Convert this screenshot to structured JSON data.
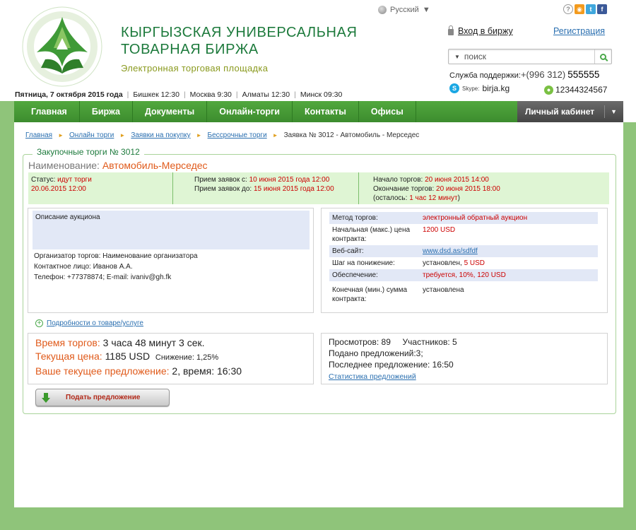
{
  "header": {
    "title_line1": "КЫРГЫЗСКАЯ УНИВЕРСАЛЬНАЯ",
    "title_line2": "ТОВАРНАЯ БИРЖА",
    "subtitle": "Электронная торговая площадка",
    "language": "Русский",
    "login": "Вход в биржу",
    "register": "Регистрация",
    "search_placeholder": "поиск",
    "support_label": "Служба поддержки:",
    "support_code": "+(996 312)",
    "support_number": "555555",
    "skype_label": "Skype:",
    "skype_value": "birja.kg",
    "icq_value": "12344324567",
    "date": "Пятница, 7 октября 2015 года",
    "times": [
      "Бишкек 12:30",
      "Москва 9:30",
      "Алматы 12:30",
      "Минск 09:30"
    ]
  },
  "nav": {
    "items": [
      "Главная",
      "Биржа",
      "Документы",
      "Онлайн-торги",
      "Контакты",
      "Офисы"
    ],
    "cabinet": "Личный кабинет"
  },
  "breadcrumb": {
    "items": [
      "Главная",
      "Онлайн торги",
      "Заявки на покупку",
      "Бессрочные торги"
    ],
    "current": "Заявка № 3012 - Автомобиль - Мерседес"
  },
  "lot": {
    "legend": "Закупочные торги № 3012",
    "name_label": "Наименование:",
    "name_value": "Автомобиль-Мерседес",
    "status_label": "Статус:",
    "status_value": "идут торги",
    "status_date": "20.06.2015 12:00",
    "accept_from_label": "Прием заявок с:",
    "accept_from_value": "10 июня 2015 года 12:00",
    "accept_to_label": "Прием заявок до:",
    "accept_to_value": "15 июня 2015 года 12:00",
    "start_label": "Начало торгов:",
    "start_value": "20 июня 2015 14:00",
    "end_label": "Окончание торгов:",
    "end_value": "20 июня 2015 18:00",
    "left_prefix": "(осталось:",
    "left_value": "1 час 12 минут",
    "left_suffix": ")"
  },
  "description": {
    "title": "Описание аукциона",
    "organizer": "Организатор торгов: Наименование организатора",
    "contact": "Контактное лицо: Иванов А.А.",
    "phone": "Телефон: +77378874; E-mail: ivaniv@gh.fk"
  },
  "params": {
    "rows": [
      {
        "key": "Метод торгов:",
        "value": "электронный обратный аукцион"
      },
      {
        "key": "Начальная (макс.) цена контракта:",
        "value": "1200 USD"
      },
      {
        "key": "Веб-сайт:",
        "value": "www.dsd.as/sdfdf"
      },
      {
        "key": "Шаг на понижение:",
        "value": "установлен, 5 USD"
      },
      {
        "key": "Обеспечение:",
        "value": "требуется, 10%, 120 USD"
      },
      {
        "key": "Конечная (мин.) сумма контракта:",
        "value": "установлена"
      }
    ],
    "step_prefix": "установлен,",
    "step_amount": "5 USD"
  },
  "details_link": "Подробности о товаре/услуге",
  "trading": {
    "time_label": "Время торгов:",
    "time_value": "3 часа 48 минут 3 сек.",
    "price_label": "Текущая цена:",
    "price_value": "1185 USD",
    "decrease": "Снижение: 1,25%",
    "offer_label": "Ваше текущее предложение:",
    "offer_value": "2, время: 16:30"
  },
  "stats": {
    "views": "Просмотров: 89",
    "participants": "Участников: 5",
    "offers": "Подано предложений:3;",
    "last_offer": "Последнее предложение: 16:50",
    "stats_link": "Статистика предложений"
  },
  "offer_button": "Подать предложение"
}
